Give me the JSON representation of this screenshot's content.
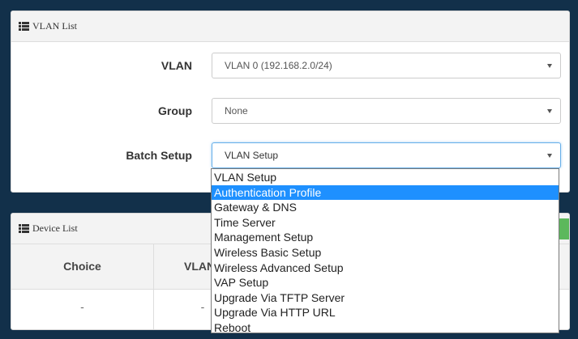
{
  "vlan_list": {
    "title": "VLAN List",
    "fields": [
      {
        "label": "VLAN",
        "value": "VLAN 0 (192.168.2.0/24)"
      },
      {
        "label": "Group",
        "value": "None"
      },
      {
        "label": "Batch Setup",
        "value": "VLAN Setup"
      }
    ]
  },
  "batch_dropdown": {
    "selected_index": 1,
    "options": [
      "VLAN Setup",
      "Authentication Profile",
      "Gateway & DNS",
      "Time Server",
      "Management Setup",
      "Wireless Basic Setup",
      "Wireless Advanced Setup",
      "VAP Setup",
      "Upgrade Via TFTP Server",
      "Upgrade Via HTTP URL",
      "Reboot"
    ]
  },
  "device_list": {
    "title": "Device List",
    "columns": [
      "Choice",
      "VLAN#"
    ],
    "rows": [
      [
        "-",
        "-"
      ]
    ]
  },
  "colors": {
    "background": "#12304a",
    "highlight": "#1e90ff",
    "green_button": "#5cb85c"
  },
  "icons": {
    "panel_header": "list-icon",
    "select_caret": "caret-down-icon"
  }
}
